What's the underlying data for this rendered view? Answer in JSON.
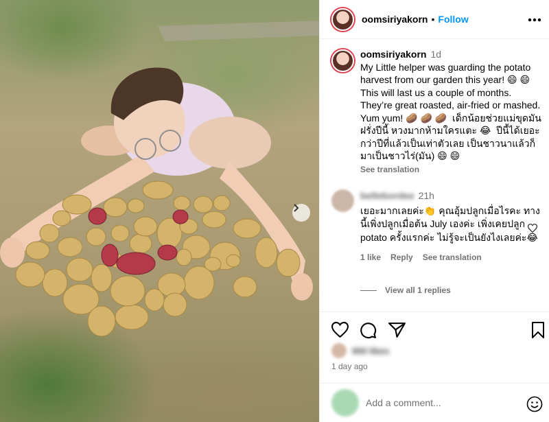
{
  "post": {
    "username": "oomsiriyakorn",
    "follow_label": "Follow",
    "separator": "•",
    "more_label": "•••",
    "next_label": "›"
  },
  "caption": {
    "username": "oomsiriyakorn",
    "time": "1d",
    "text": "My Little helper was guarding the potato harvest from our garden this year! 😄 😄  This will last us a couple of months. They’re great roasted, air-fried or mashed. Yum yum! 🥔 🥔 🥔  เด็กน้อยช่วยแม่ขุดมันฝรั่งปีนี้ หวงมากห้ามใครแตะ 😂  ปีนี้ได้เยอะกว่าปีที่แล้วเป็นเท่าตัวเลย เป็นชาวนาแล้วก็มาเป็นชาวไร่(มัน) 😄 😄",
    "see_translation": "See translation"
  },
  "comment": {
    "username": "bellebordee",
    "time": "21h",
    "text": "เยอะมากเลยค่ะ👏 คุณอุ้มปลูกเมื่อไรคะ ทางนี้เพิ่งปลูกเมื่อต้น July เองค่ะ เพิ่งเคยปลูก potato ครั้งแรกค่ะ ไม่รู้จะเป็นยังไงเลยค่ะ😂",
    "likes": "1 like",
    "reply": "Reply",
    "see_translation": "See translation",
    "view_replies": "View all 1 replies"
  },
  "likes": {
    "text": "900 likes"
  },
  "date": "1 day ago",
  "add_comment": {
    "placeholder": "Add a comment..."
  },
  "icons": {
    "heart": "heart-icon",
    "comment": "comment-icon",
    "share": "share-icon",
    "save": "bookmark-icon",
    "emoji": "emoji-icon"
  },
  "colors": {
    "accent": "#0095f6",
    "muted": "#737373",
    "border": "#efefef"
  }
}
